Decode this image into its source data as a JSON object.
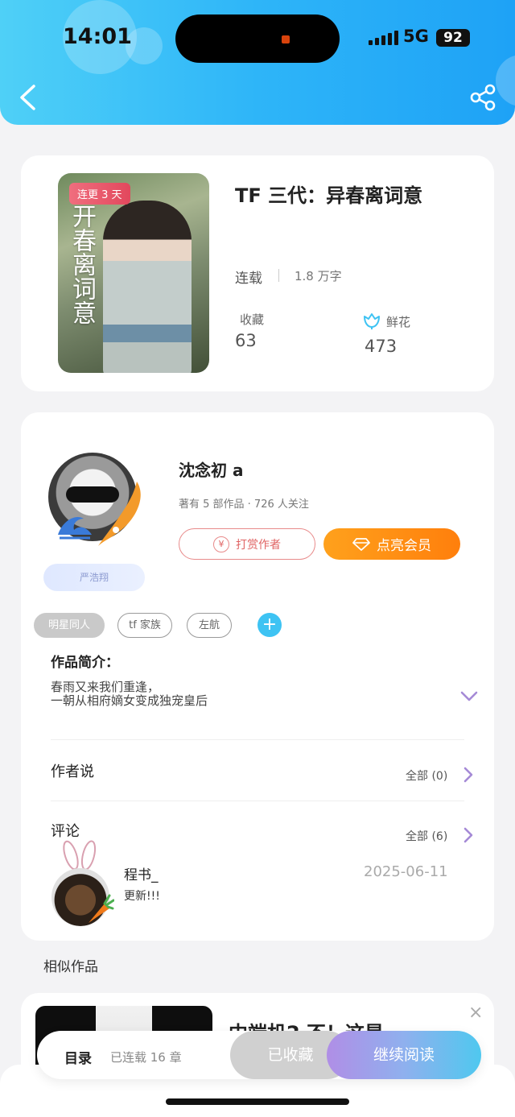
{
  "status_bar": {
    "time": "14:01",
    "network": "5G",
    "battery": "92"
  },
  "book": {
    "cover_badge": "连更 3 天",
    "title": "TF 三代：异春离词意",
    "status": "连载",
    "words": "1.8 万字",
    "favorites_label": "收藏",
    "favorites_value": "63",
    "flowers_label": "鲜花",
    "flowers_value": "473"
  },
  "author": {
    "name": "沈念初 a",
    "meta": "著有 5 部作品 · 726 人关注",
    "badge": "严浩翔",
    "tip_label": "打赏作者",
    "tip_icon_glyph": "¥",
    "vip_label": "点亮会员"
  },
  "tags": [
    {
      "label": "明星同人"
    },
    {
      "label": "tf 家族"
    },
    {
      "label": "左航"
    }
  ],
  "tag_add": "+",
  "intro": {
    "title": "作品简介：",
    "lines": [
      "春雨又来我们重逢，",
      "一朝从相府嫡女变成独宠皇后"
    ]
  },
  "author_says": {
    "title": "作者说",
    "all": "全部 (0)"
  },
  "comments": {
    "title": "评论",
    "all": "全部 (6)",
    "items": [
      {
        "user": "程书_",
        "text": "更新!!!",
        "date": "2025-06-11"
      }
    ]
  },
  "similar": {
    "title": "相似作品",
    "items": [
      {
        "title": "中端机2 不！这是"
      }
    ],
    "close": "×"
  },
  "bottom_bar": {
    "toc": "目录",
    "chapters": "已连载 16 章",
    "collected": "已收藏",
    "continue": "继续阅读"
  },
  "colors": {
    "header": "#2eb5f8",
    "vip_button": "#ff8f14",
    "accent_purple": "#a58ad6",
    "tip_red": "#e06464"
  }
}
